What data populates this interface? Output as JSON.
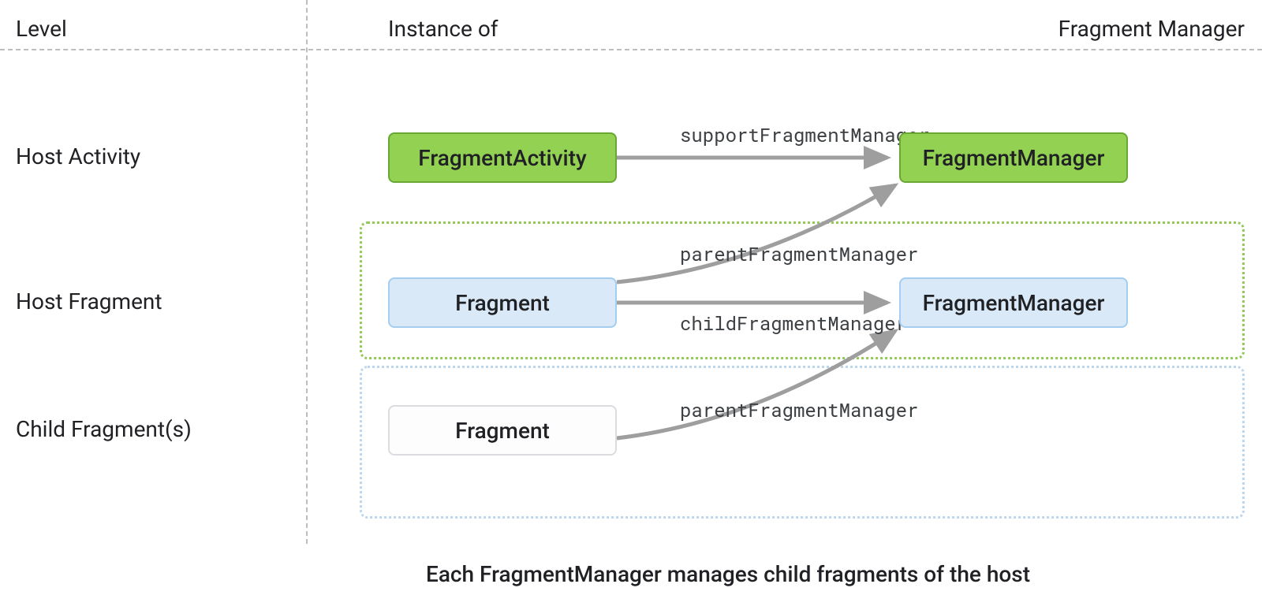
{
  "headers": {
    "level": "Level",
    "instance_of": "Instance of",
    "fragment_manager": "Fragment Manager"
  },
  "rows": {
    "host_activity": "Host Activity",
    "host_fragment": "Host Fragment",
    "child_fragments": "Child Fragment(s)"
  },
  "boxes": {
    "fragment_activity": "FragmentActivity",
    "fragment_manager_green": "FragmentManager",
    "fragment_blue": "Fragment",
    "fragment_manager_blue": "FragmentManager",
    "fragment_white": "Fragment"
  },
  "edges": {
    "support_fm": "supportFragmentManager",
    "parent_fm_1": "parentFragmentManager",
    "child_fm": "childFragmentManager",
    "parent_fm_2": "parentFragmentManager"
  },
  "caption": "Each FragmentManager manages child fragments of the host",
  "colors": {
    "green_fill": "#93d152",
    "green_border": "#6aa734",
    "blue_fill": "#d9e9f7",
    "blue_border": "#a5cdef",
    "arrow": "#9e9e9e"
  }
}
